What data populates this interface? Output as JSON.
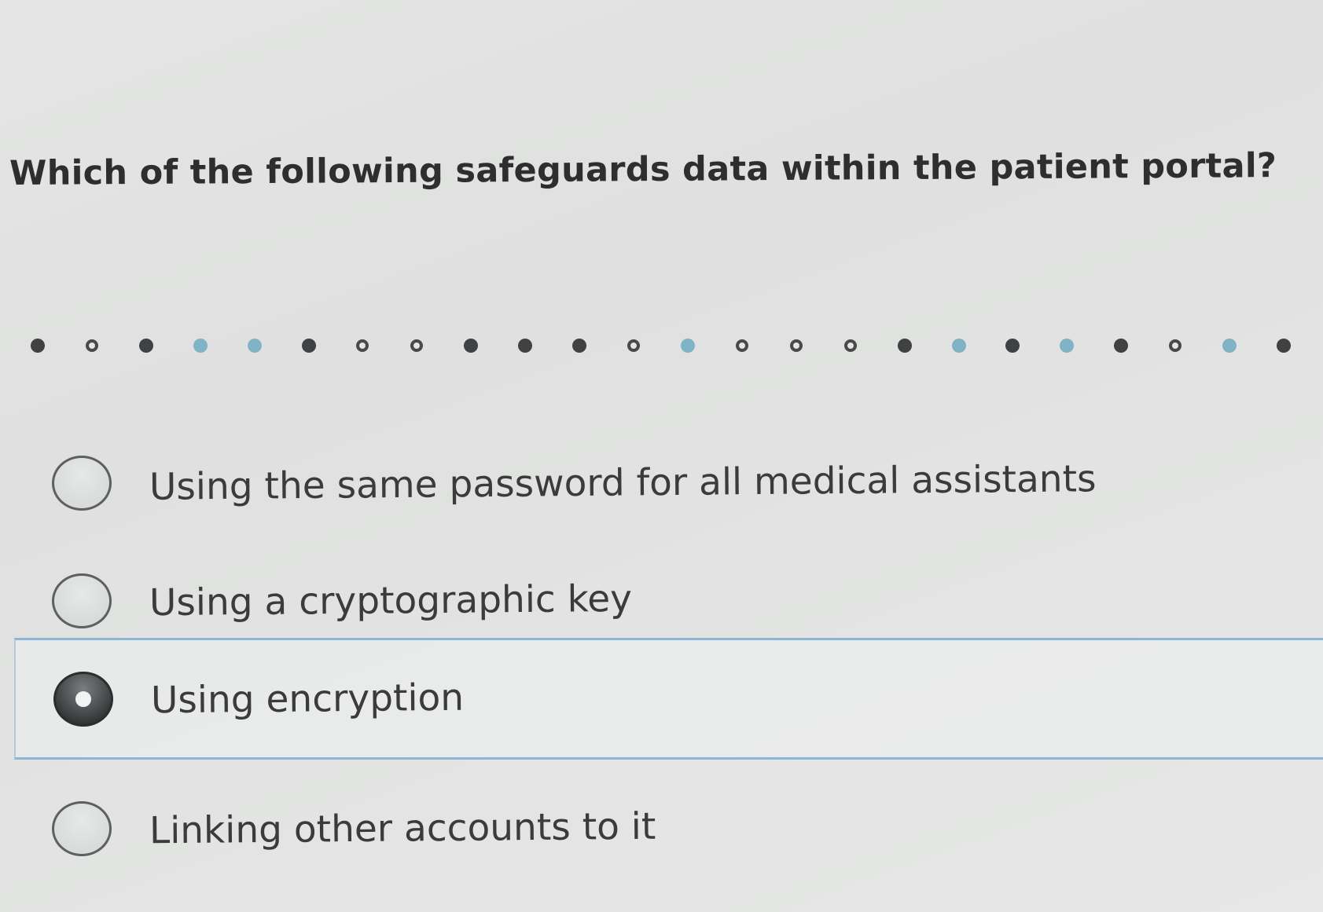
{
  "question": {
    "text": "Which of the following safeguards data within the patient portal?"
  },
  "progress": {
    "dots": [
      "filled",
      "open",
      "filled",
      "current",
      "current",
      "filled",
      "open",
      "open",
      "filled",
      "filled",
      "filled",
      "open",
      "current",
      "open",
      "open",
      "open",
      "filled",
      "current",
      "filled",
      "current",
      "filled",
      "open",
      "current",
      "filled"
    ]
  },
  "options": [
    {
      "label": "Using the same password for all medical assistants",
      "selected": false
    },
    {
      "label": "Using a cryptographic key",
      "selected": false
    },
    {
      "label": "Using encryption",
      "selected": true
    },
    {
      "label": "Linking other accounts to it",
      "selected": false
    }
  ],
  "colors": {
    "background": "#e2e3e2",
    "selected_border": "#8cb6d6",
    "current_dot": "#7fb4c6",
    "text": "#3b3b3b"
  }
}
